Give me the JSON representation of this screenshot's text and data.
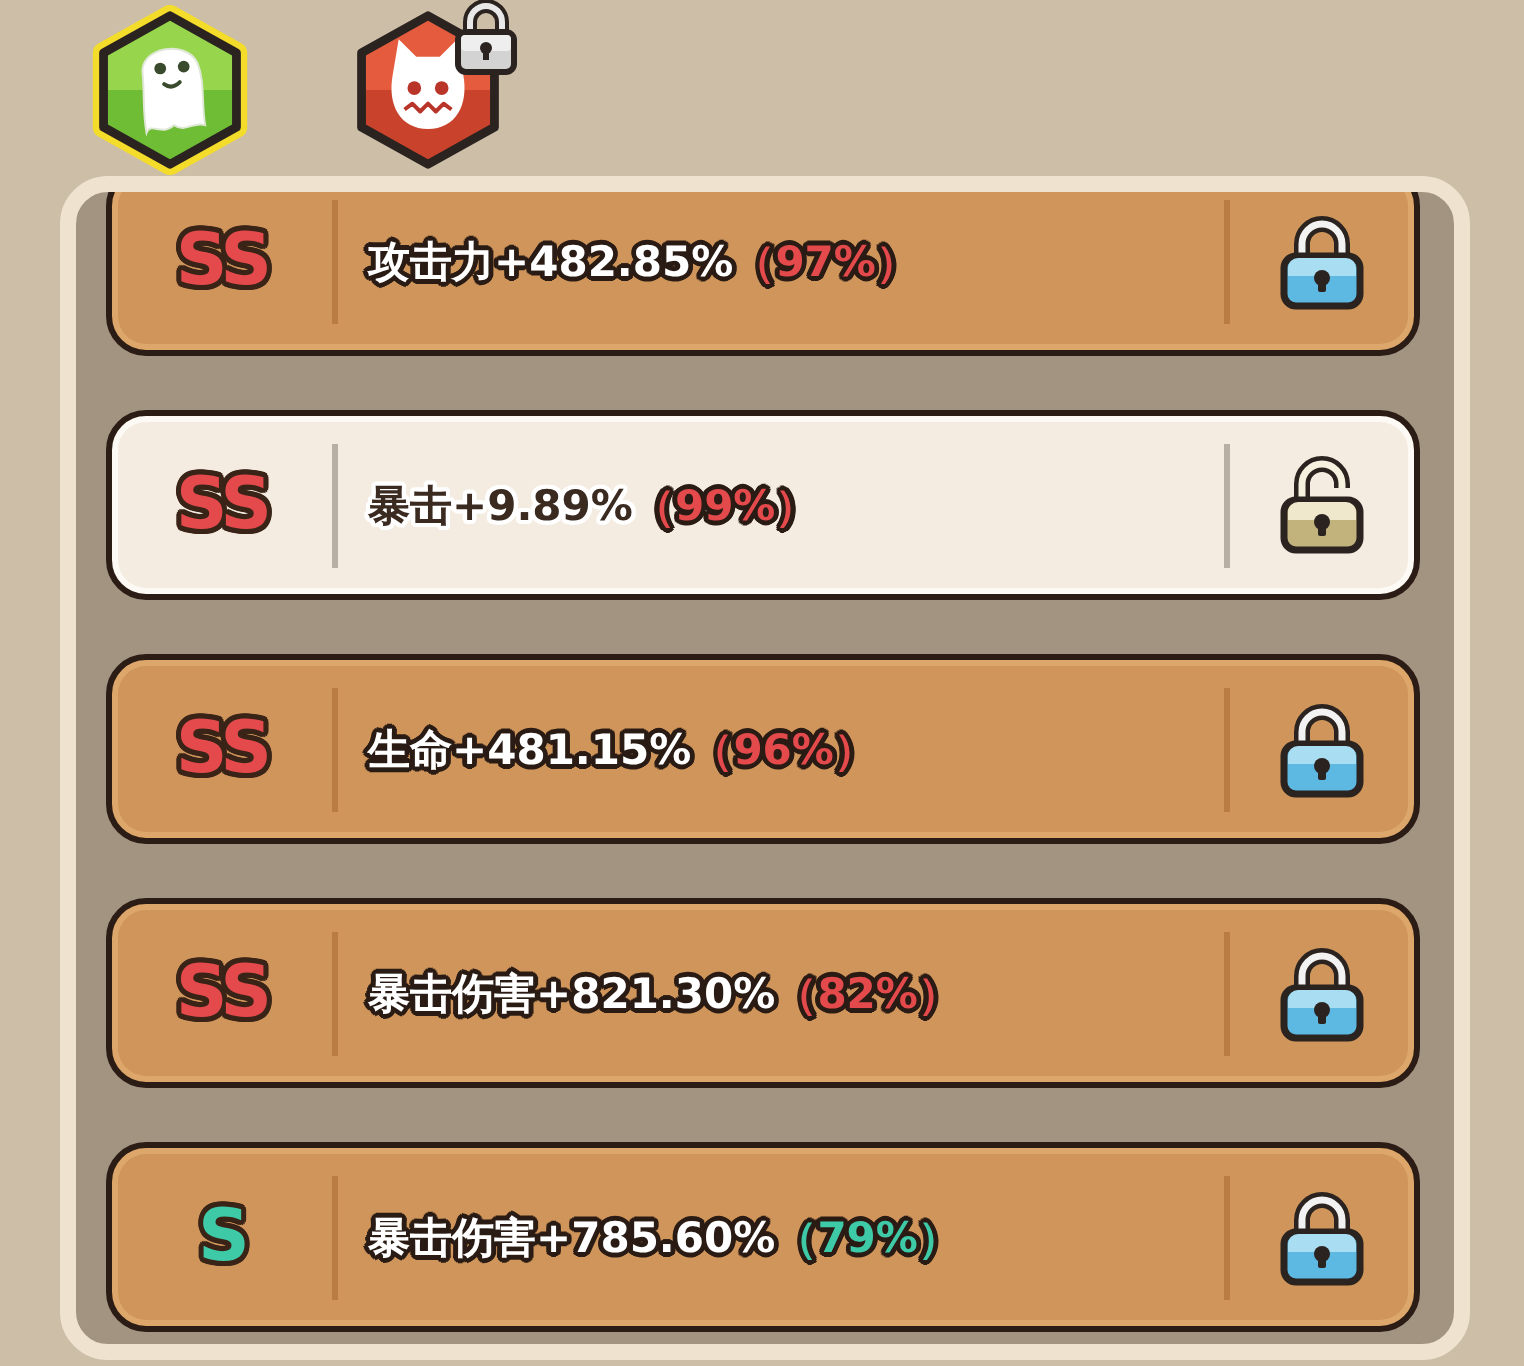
{
  "tabs": [
    {
      "kind": "ghost",
      "selected": true,
      "locked": false
    },
    {
      "kind": "cat",
      "selected": false,
      "locked": true
    }
  ],
  "affixes": [
    {
      "grade": "SS",
      "color": "#e44a4c",
      "stat": "攻击力+482.85%",
      "roll": "（97%）",
      "selected": false,
      "locked": true
    },
    {
      "grade": "SS",
      "color": "#e44a4c",
      "stat": "暴击+9.89%",
      "roll": "（99%）",
      "selected": true,
      "locked": false
    },
    {
      "grade": "SS",
      "color": "#e44a4c",
      "stat": "生命+481.15%",
      "roll": "（96%）",
      "selected": false,
      "locked": true
    },
    {
      "grade": "SS",
      "color": "#e44a4c",
      "stat": "暴击伤害+821.30%",
      "roll": "（82%）",
      "selected": false,
      "locked": true
    },
    {
      "grade": "S",
      "color": "#3ec9a7",
      "stat": "暴击伤害+785.60%",
      "roll": "（79%）",
      "selected": false,
      "locked": true
    }
  ]
}
